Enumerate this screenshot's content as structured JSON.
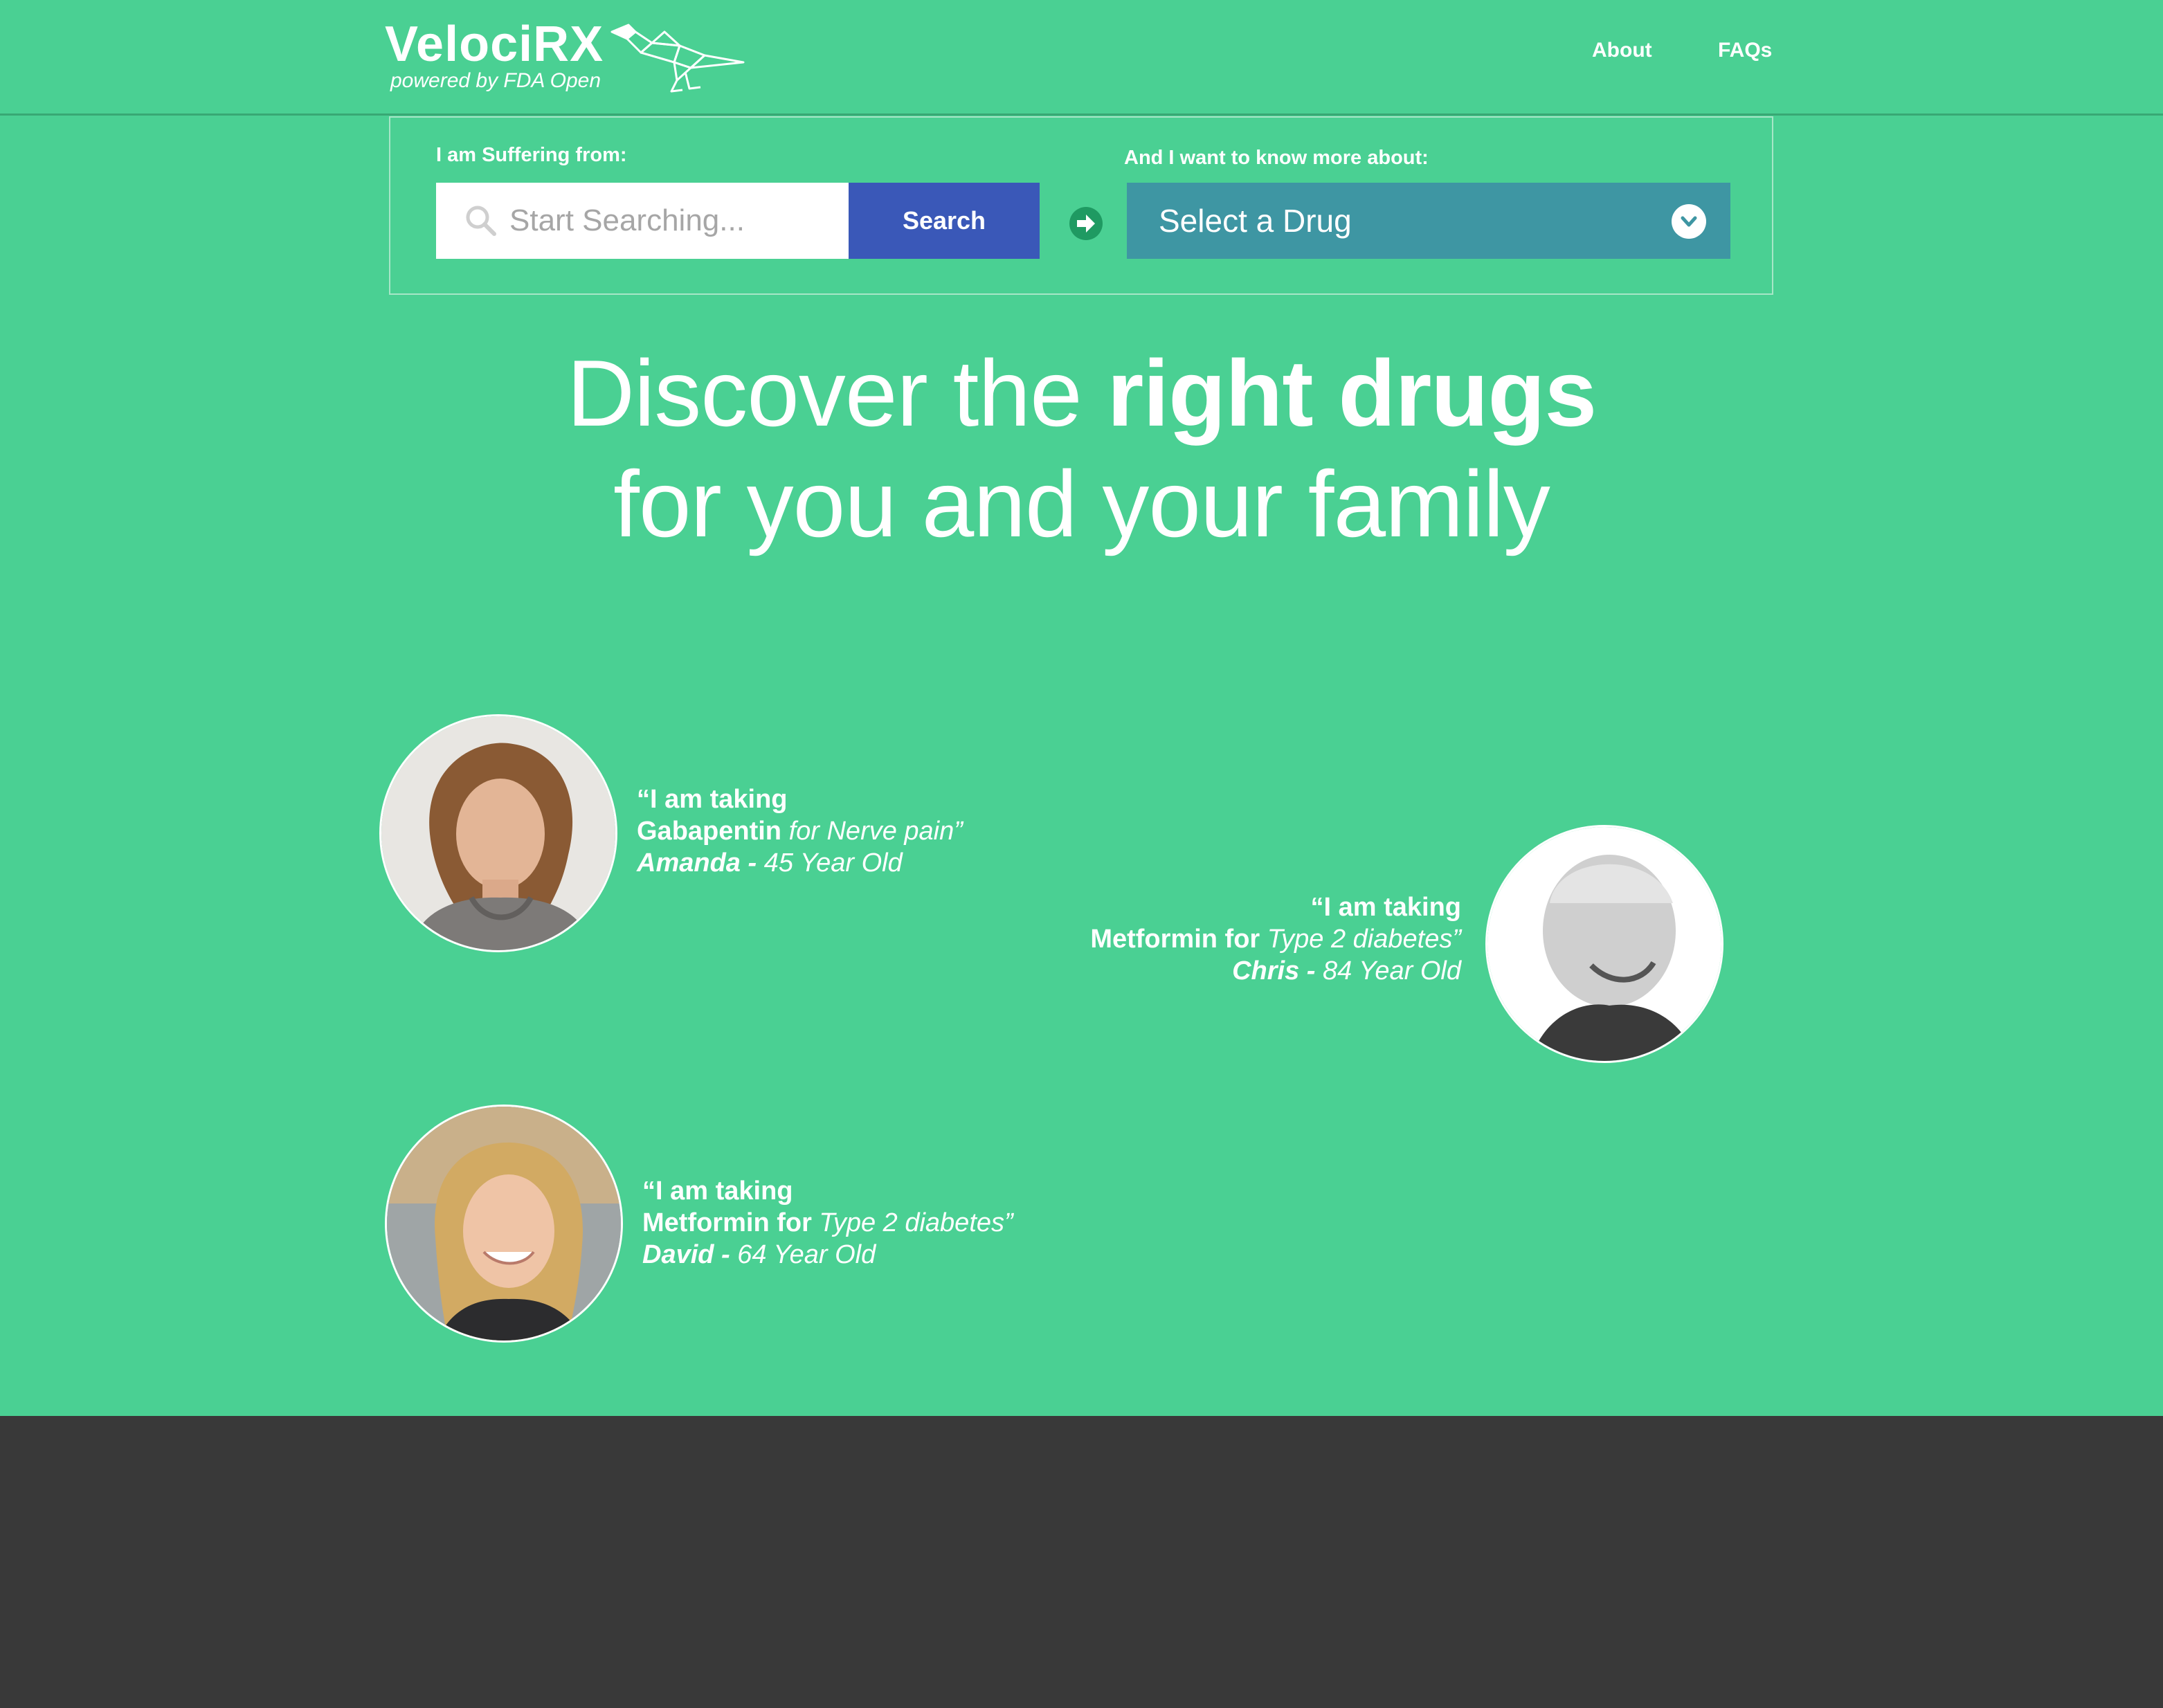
{
  "brand": {
    "name": "VelociRX",
    "tagline": "powered by FDA Open"
  },
  "nav": {
    "about": "About",
    "faqs": "FAQs"
  },
  "search": {
    "left_label": "I am Suffering from:",
    "placeholder": "Start Searching...",
    "button_label": "Search",
    "right_label": "And I want to know more about:",
    "select_label": "Select a Drug"
  },
  "hero": {
    "line1_light": "Discover the ",
    "line1_bold": "right drugs",
    "line2": "for you and your family"
  },
  "testimonials": [
    {
      "line1": "“I am taking",
      "drug": "Gabapentin",
      "connector": "",
      "condition": " for Nerve pain”",
      "name": "Amanda -",
      "age": " 45 Year Old"
    },
    {
      "line1": "“I am taking",
      "drug": "Metformin for",
      "connector": "",
      "condition": " Type 2 diabetes”",
      "name": "Chris -",
      "age": " 84 Year Old"
    },
    {
      "line1": "“I am taking",
      "drug": "Metformin for",
      "connector": "",
      "condition": " Type 2 diabetes”",
      "name": "David -",
      "age": " 64 Year Old"
    }
  ],
  "colors": {
    "background": "#4ad093",
    "search_button": "#3a58b8",
    "drug_select": "#3e96a3",
    "footer": "#393939"
  }
}
